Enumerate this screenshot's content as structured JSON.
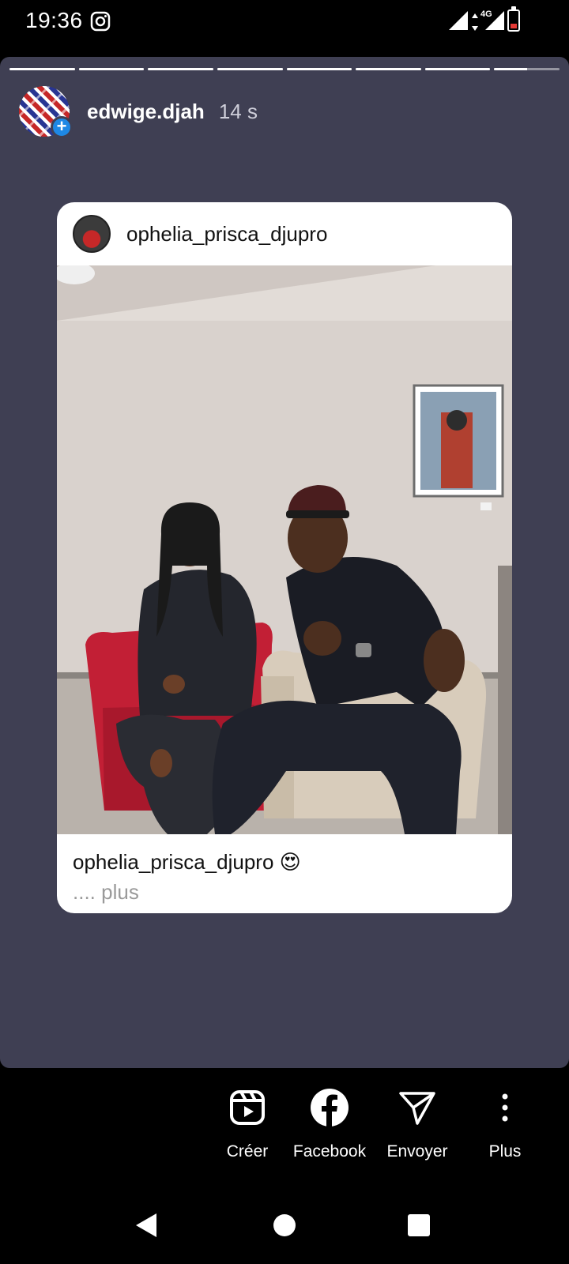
{
  "status_bar": {
    "time": "19:36",
    "network": "4G",
    "icons": [
      "instagram-icon",
      "signal-icon",
      "signal-icon",
      "battery-low-icon"
    ],
    "battery_color": "#e53935"
  },
  "story": {
    "background": "#3f3f53",
    "progress_segments": [
      1,
      1,
      1,
      1,
      1,
      1,
      1,
      0.5
    ],
    "username": "edwige.djah",
    "time_ago": "14 s",
    "avatar_badge": "+",
    "badge_color": "#1e88e5"
  },
  "shared_post": {
    "username": "ophelia_prisca_djupro",
    "caption": "ophelia_prisca_djupro 😍",
    "more": ".... plus"
  },
  "actions": [
    {
      "label": "Créer",
      "icon": "reels-icon"
    },
    {
      "label": "Facebook",
      "icon": "facebook-icon"
    },
    {
      "label": "Envoyer",
      "icon": "send-icon"
    },
    {
      "label": "Plus",
      "icon": "more-vertical-icon"
    }
  ],
  "nav": [
    "back-icon",
    "home-icon",
    "recents-icon"
  ]
}
